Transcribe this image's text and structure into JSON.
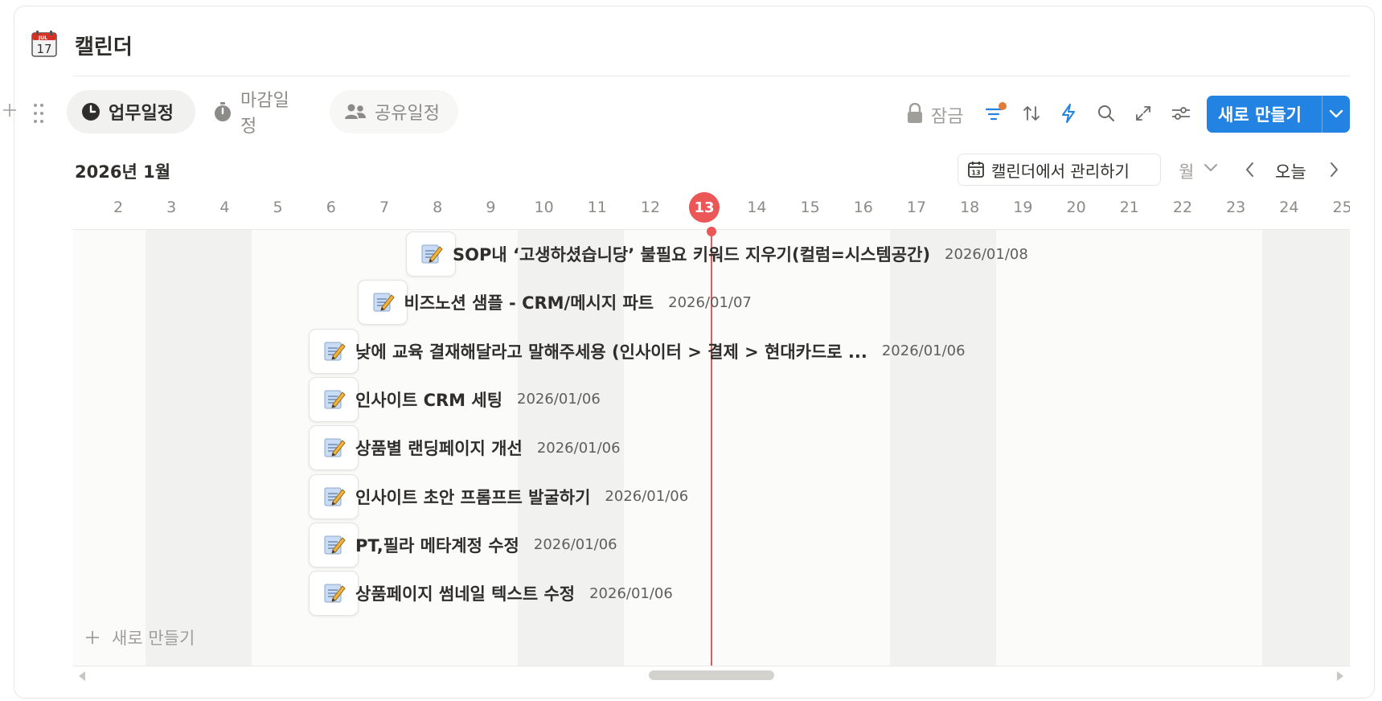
{
  "page": {
    "title": "캘린더"
  },
  "tabs": [
    {
      "label": "업무일정",
      "active": true,
      "icon": "clock-filled-icon"
    },
    {
      "label": "마감일정",
      "active": false,
      "icon": "stopwatch-icon"
    },
    {
      "label": "공유일정",
      "active": false,
      "icon": "people-icon"
    }
  ],
  "toolbar": {
    "lock_label": "잠금",
    "new_button_label": "새로 만들기",
    "accent": "#2383e2",
    "filter_badge_color": "#e07b39"
  },
  "calendar": {
    "month_label": "2026년 1월",
    "manage_label": "캘린더에서 관리하기",
    "view_mode": "월",
    "today_label": "오늘",
    "today_day": "13",
    "today_color": "#eb5757",
    "days": [
      "2",
      "3",
      "4",
      "5",
      "6",
      "7",
      "8",
      "9",
      "10",
      "11",
      "12",
      "13",
      "14",
      "15",
      "16",
      "17",
      "18",
      "19",
      "20",
      "21",
      "22",
      "23",
      "24",
      "25"
    ]
  },
  "events": [
    {
      "title": "SOP내 ‘고생하셨습니당’ 불필요 키워드 지우기(컬럼=시스템공간)",
      "date": "2026/01/08",
      "icon": "memo-icon"
    },
    {
      "title": "비즈노션 샘플 - CRM/메시지 파트",
      "date": "2026/01/07",
      "icon": "memo-icon"
    },
    {
      "title": "낮에 교육 결재해달라고 말해주세용 (인사이터 > 결제 > 현대카드로 ...",
      "date": "2026/01/06",
      "icon": "memo-icon"
    },
    {
      "title": "인사이트 CRM 세팅",
      "date": "2026/01/06",
      "icon": "memo-icon"
    },
    {
      "title": "상품별 랜딩페이지 개선",
      "date": "2026/01/06",
      "icon": "memo-icon"
    },
    {
      "title": "인사이트 초안 프롬프트 발굴하기",
      "date": "2026/01/06",
      "icon": "memo-icon"
    },
    {
      "title": "PT,필라 메타계정 수정",
      "date": "2026/01/06",
      "icon": "memo-icon"
    },
    {
      "title": "상품페이지 썸네일 텍스트 수정",
      "date": "2026/01/06",
      "icon": "memo-icon"
    }
  ],
  "add_row_label": "새로 만들기"
}
